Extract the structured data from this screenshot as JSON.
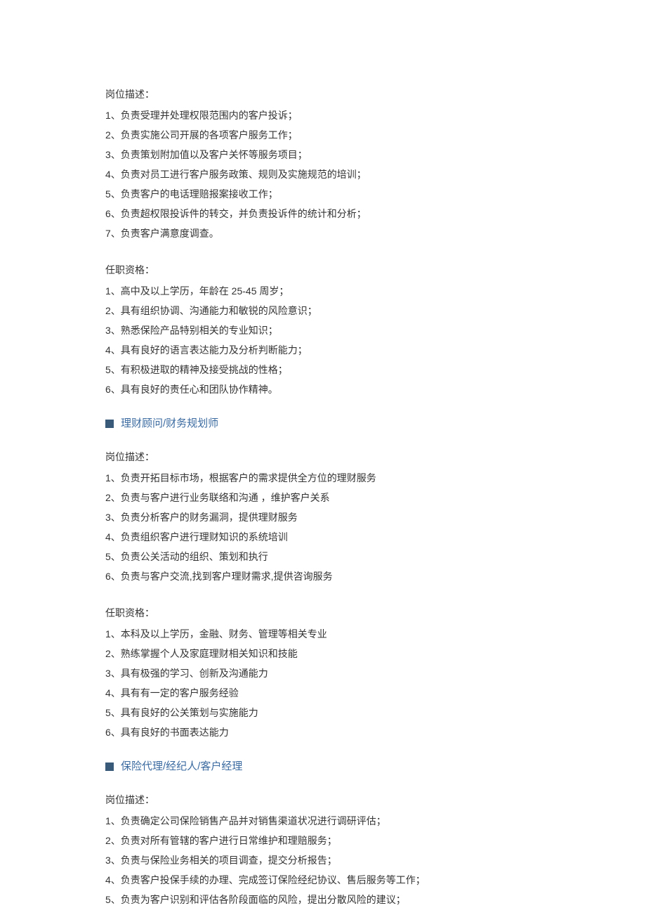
{
  "section1": {
    "jobDescHeader": "岗位描述：",
    "jobDescItems": [
      "1、负责受理并处理权限范围内的客户投诉；",
      "2、负责实施公司开展的各项客户服务工作；",
      "3、负责策划附加值以及客户关怀等服务项目；",
      "4、负责对员工进行客户服务政策、规则及实施规范的培训；",
      "5、负责客户的电话理赔报案接收工作；",
      "6、负责超权限投诉件的转交，并负责投诉件的统计和分析；",
      "7、负责客户满意度调查。"
    ],
    "qualHeader": "任职资格：",
    "qualItems": [
      "1、高中及以上学历，年龄在 25-45 周岁；",
      "2、具有组织协调、沟通能力和敏锐的风险意识；",
      "3、熟悉保险产品特别相关的专业知识；",
      "4、具有良好的语言表达能力及分析判断能力；",
      "5、有积极进取的精神及接受挑战的性格；",
      "6、具有良好的责任心和团队协作精神。"
    ]
  },
  "section2": {
    "title": "理财顾问/财务规划师",
    "jobDescHeader": "岗位描述：",
    "jobDescItems": [
      "1、负责开拓目标市场，根据客户的需求提供全方位的理财服务",
      "2、负责与客户进行业务联络和沟通  ，维护客户关系",
      "3、负责分析客户的财务漏洞，提供理财服务",
      "4、负责组织客户进行理财知识的系统培训",
      "5、负责公关活动的组织、策划和执行",
      "6、负责与客户交流,找到客户理财需求,提供咨询服务"
    ],
    "qualHeader": "任职资格：",
    "qualItems": [
      "1、本科及以上学历，金融、财务、管理等相关专业",
      "2、熟练掌握个人及家庭理财相关知识和技能",
      "3、具有极强的学习、创新及沟通能力",
      "4、具有有一定的客户服务经验",
      "5、具有良好的公关策划与实施能力",
      "6、具有良好的书面表达能力"
    ]
  },
  "section3": {
    "title": "保险代理/经纪人/客户经理",
    "jobDescHeader": "岗位描述：",
    "jobDescItems": [
      "1、负责确定公司保险销售产品并对销售渠道状况进行调研评估；",
      "2、负责对所有管辖的客户进行日常维护和理赔服务；",
      "3、负责与保险业务相关的项目调查，提交分析报告；",
      "4、负责客户投保手续的办理、完成签订保险经纪协议、售后服务等工作；",
      "5、负责为客户识别和评估各阶段面临的风险，提出分散风险的建议；"
    ]
  }
}
